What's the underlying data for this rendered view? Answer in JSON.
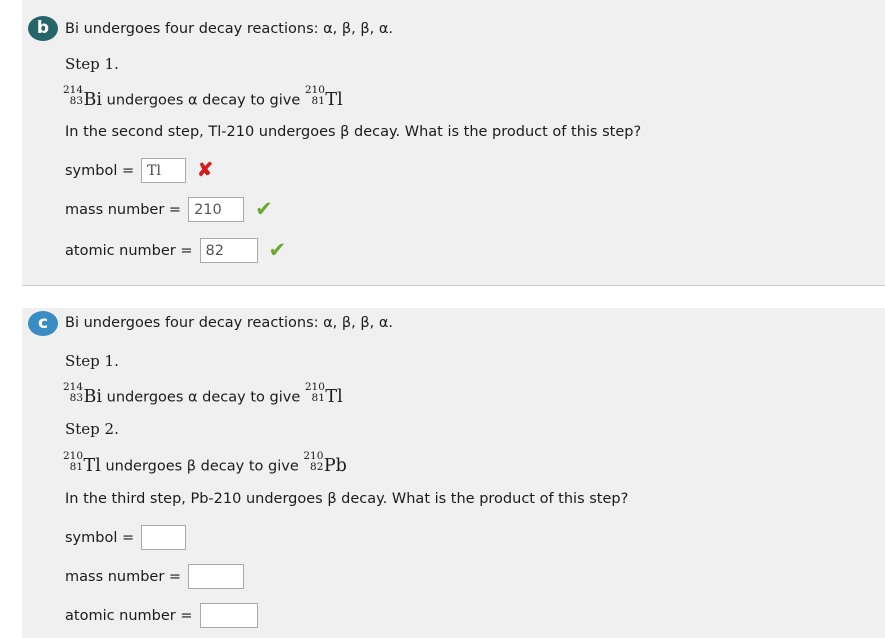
{
  "sections": [
    {
      "id": "b",
      "badge_label": "b",
      "badge_color": "#26666b",
      "intro": "Bi undergoes four decay reactions: α, β, β, α.",
      "steps": [
        {
          "label": "Step 1.",
          "equation": {
            "reactant": {
              "mass": "214",
              "atomic": "83",
              "symbol": "Bi"
            },
            "middle": "undergoes α decay to give",
            "product": {
              "mass": "210",
              "atomic": "81",
              "symbol": "Tl"
            }
          }
        }
      ],
      "question": "In the second step, Tl-210 undergoes β decay. What is the product of this step?",
      "answers": [
        {
          "label": "symbol =",
          "value": "Tl",
          "placeholder": "",
          "mark": "✘",
          "mark_type": "incorrect",
          "mark_color": "#d31e1e"
        },
        {
          "label": "mass number =",
          "value": "210",
          "placeholder": "",
          "mark": "✔",
          "mark_type": "correct",
          "mark_color": "#6aa832"
        },
        {
          "label": "atomic number =",
          "value": "82",
          "placeholder": "",
          "mark": "✔",
          "mark_type": "correct",
          "mark_color": "#6aa832"
        }
      ]
    },
    {
      "id": "c",
      "badge_label": "c",
      "badge_color": "#3a8dc4",
      "intro": "Bi undergoes four decay reactions: α, β, β, α.",
      "steps": [
        {
          "label": "Step 1.",
          "equation": {
            "reactant": {
              "mass": "214",
              "atomic": "83",
              "symbol": "Bi"
            },
            "middle": "undergoes α decay to give",
            "product": {
              "mass": "210",
              "atomic": "81",
              "symbol": "Tl"
            }
          }
        },
        {
          "label": "Step 2.",
          "equation": {
            "reactant": {
              "mass": "210",
              "atomic": "81",
              "symbol": "Tl"
            },
            "middle": "undergoes β decay to give",
            "product": {
              "mass": "210",
              "atomic": "82",
              "symbol": "Pb"
            }
          }
        }
      ],
      "question": "In the third step, Pb-210 undergoes β decay. What is the product of this step?",
      "answers": [
        {
          "label": "symbol =",
          "value": "",
          "placeholder": "",
          "mark": "",
          "mark_type": "none",
          "mark_color": ""
        },
        {
          "label": "mass number =",
          "value": "",
          "placeholder": "",
          "mark": "",
          "mark_type": "none",
          "mark_color": ""
        },
        {
          "label": "atomic number =",
          "value": "",
          "placeholder": "",
          "mark": "",
          "mark_type": "none",
          "mark_color": ""
        }
      ]
    }
  ]
}
